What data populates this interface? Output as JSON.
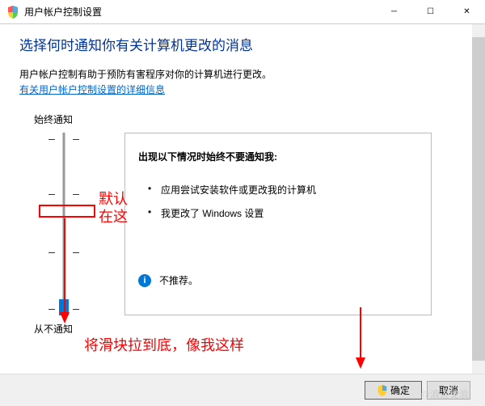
{
  "titlebar": {
    "title": "用户帐户控制设置"
  },
  "heading": "选择何时通知你有关计算机更改的消息",
  "subtext": "用户帐户控制有助于预防有害程序对你的计算机进行更改。",
  "link": "有关用户帐户控制设置的详细信息",
  "slider": {
    "top_label": "始终通知",
    "bottom_label": "从不通知"
  },
  "info": {
    "title": "出现以下情况时始终不要通知我:",
    "item1": "应用尝试安装软件或更改我的计算机",
    "item2": "我更改了 Windows 设置",
    "recommend": "不推荐。"
  },
  "footer": {
    "ok": "确定",
    "cancel": "取消"
  },
  "annotations": {
    "default_here": "默认\n在这",
    "drag_bottom": "将滑块拉到底，像我这样"
  },
  "watermark": "浪迹戈浪"
}
